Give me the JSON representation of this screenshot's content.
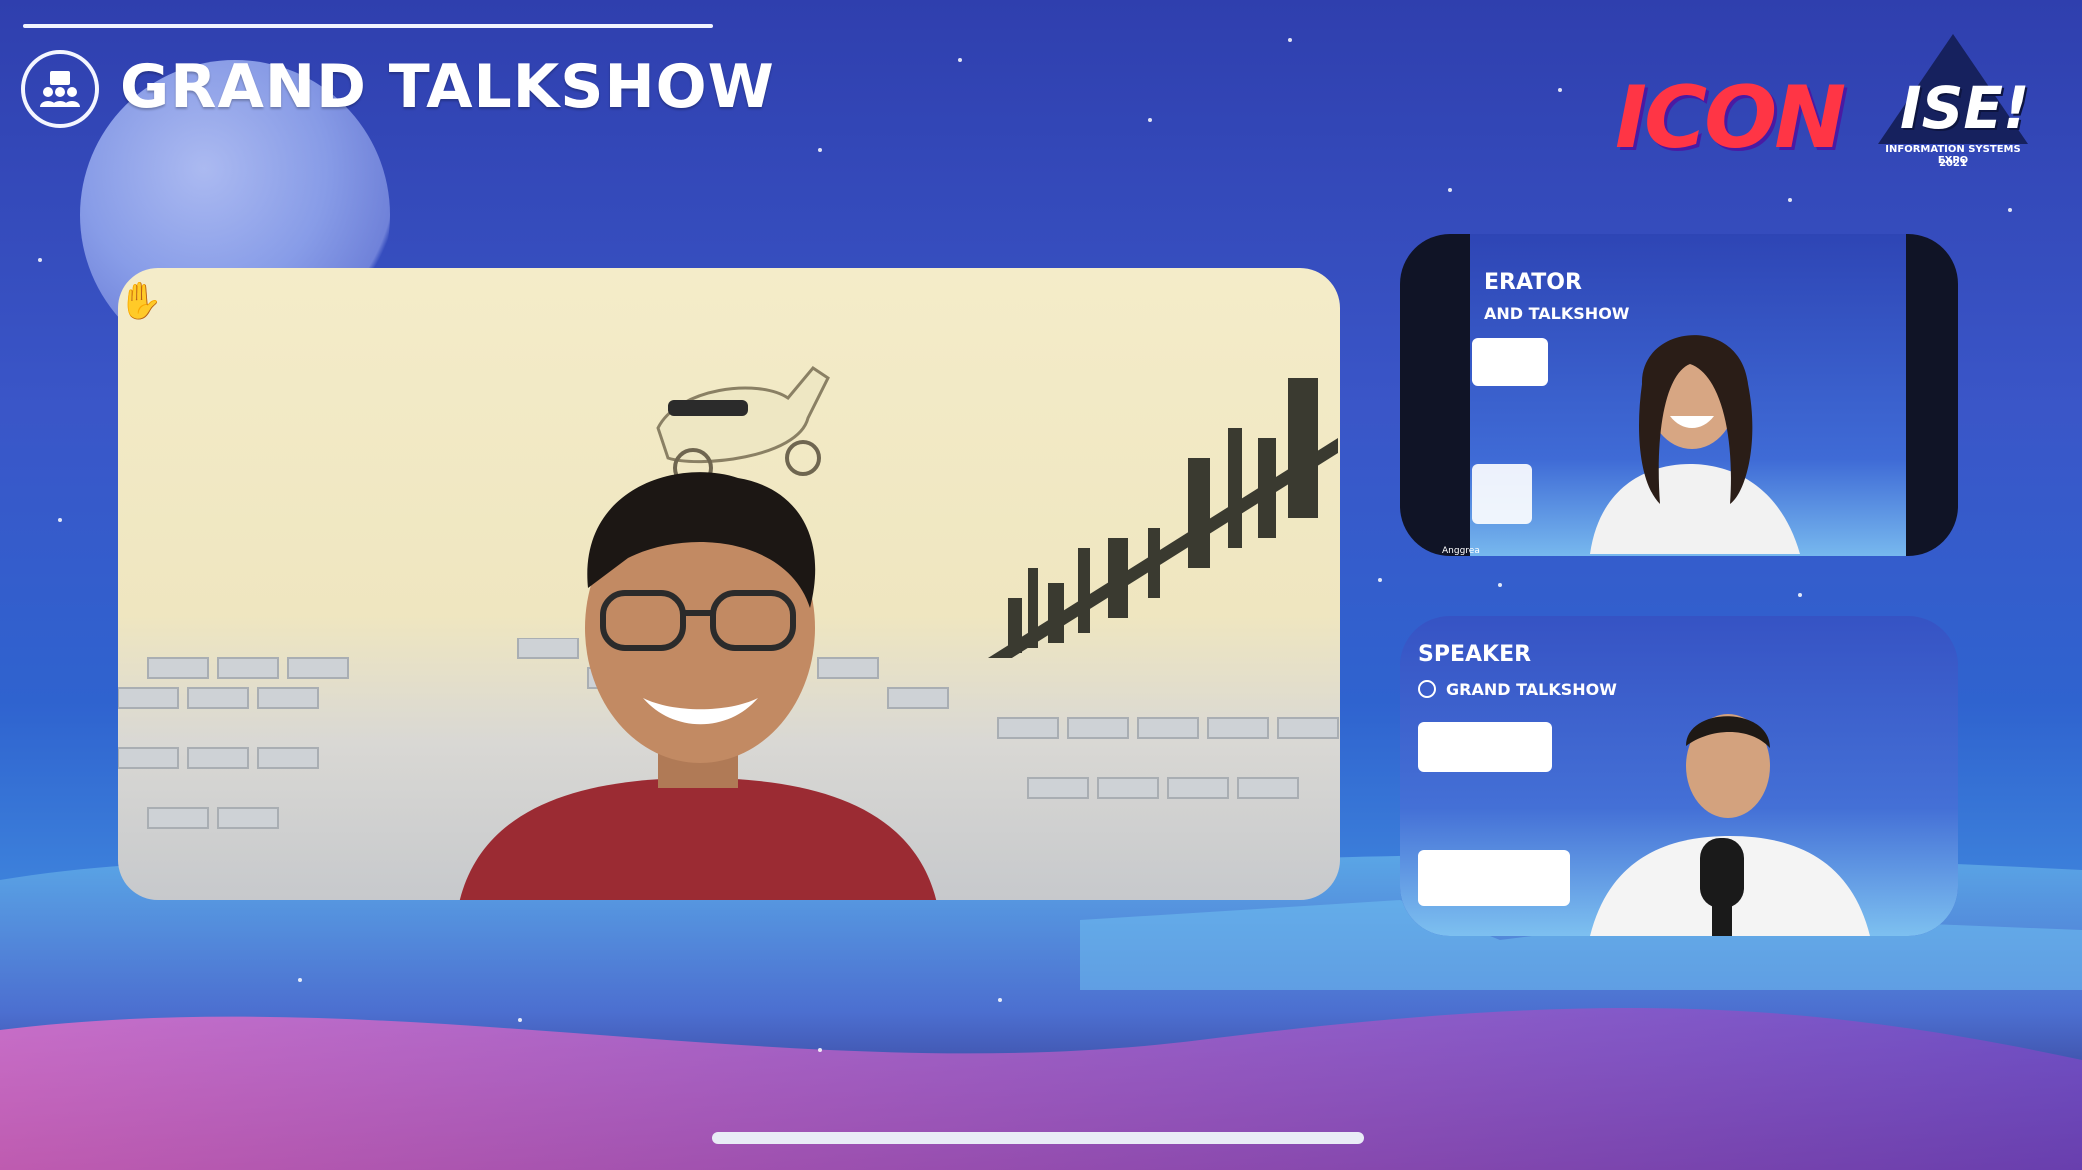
{
  "header": {
    "title": "GRAND TALKSHOW",
    "badge_icon": "talkshow-people-icon"
  },
  "logos": {
    "primary": "ICON",
    "secondary": "ISE!",
    "secondary_subtitle": "INFORMATION SYSTEMS EXPO",
    "secondary_year": "2021"
  },
  "main_video": {
    "reaction_icon": "raised-hand-icon",
    "reaction_glyph": "✋"
  },
  "participants": [
    {
      "role_label": "ERATOR",
      "event_label": "AND TALKSHOW",
      "name_tag": "Anggrea"
    },
    {
      "role_label": "SPEAKER",
      "event_label": "GRAND TALKSHOW"
    }
  ],
  "colors": {
    "accent_red": "#ff3545",
    "background_blue": "#3a56c8"
  }
}
